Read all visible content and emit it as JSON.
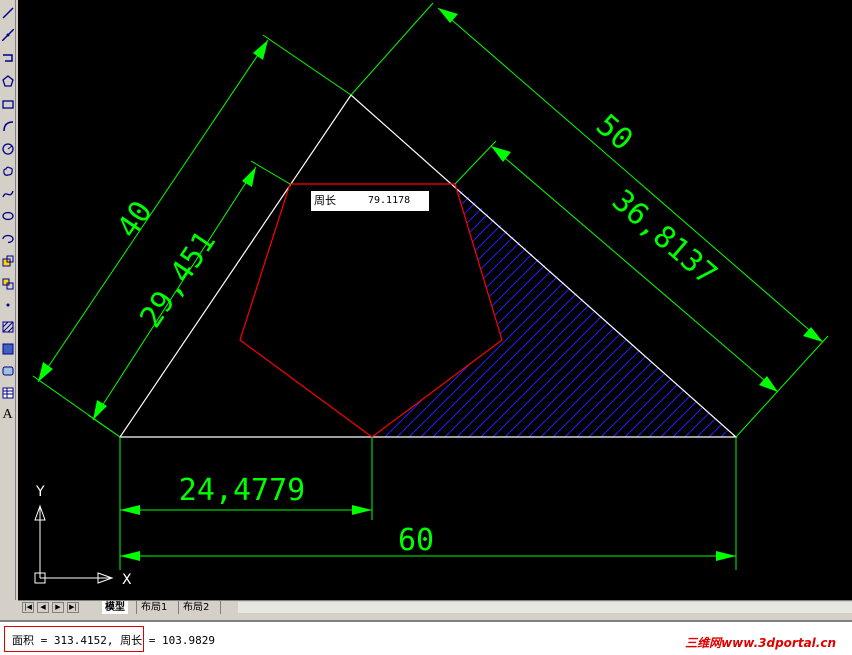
{
  "toolbar": {
    "tools": [
      "line-icon",
      "construction-line-icon",
      "polyline-icon",
      "polygon-icon",
      "rectangle-icon",
      "arc-icon",
      "circle-icon",
      "revision-cloud-icon",
      "spline-icon",
      "ellipse-icon",
      "ellipse-arc-icon",
      "insert-block-icon",
      "make-block-icon",
      "point-icon",
      "hatch-icon",
      "gradient-icon",
      "region-icon",
      "table-icon",
      "multiline-text-icon"
    ],
    "text_tool_label": "A"
  },
  "drawing": {
    "dimensions": {
      "left_outer": "40",
      "left_inner": "29,451",
      "right_outer": "50",
      "right_inner": "36,8137",
      "bottom_inner": "24,4779",
      "bottom_outer": "60"
    },
    "ucs": {
      "x_label": "X",
      "y_label": "Y"
    },
    "colors": {
      "background": "#000000",
      "dimension": "#00ff00",
      "outline": "#ffffff",
      "pentagon": "#ff0000",
      "hatch": "#2020ff"
    }
  },
  "tooltip": {
    "label": "周长",
    "value": "79.1178"
  },
  "tabs": {
    "nav": [
      "|◀",
      "◀",
      "▶",
      "▶|"
    ],
    "items": [
      "模型",
      "布局1",
      "布局2"
    ],
    "active": "模型"
  },
  "command_line": {
    "area_text": "面积 = 313.4152,",
    "perimeter_text": "周长 = 103.9829"
  },
  "watermark": "三维网www.3dportal.cn"
}
